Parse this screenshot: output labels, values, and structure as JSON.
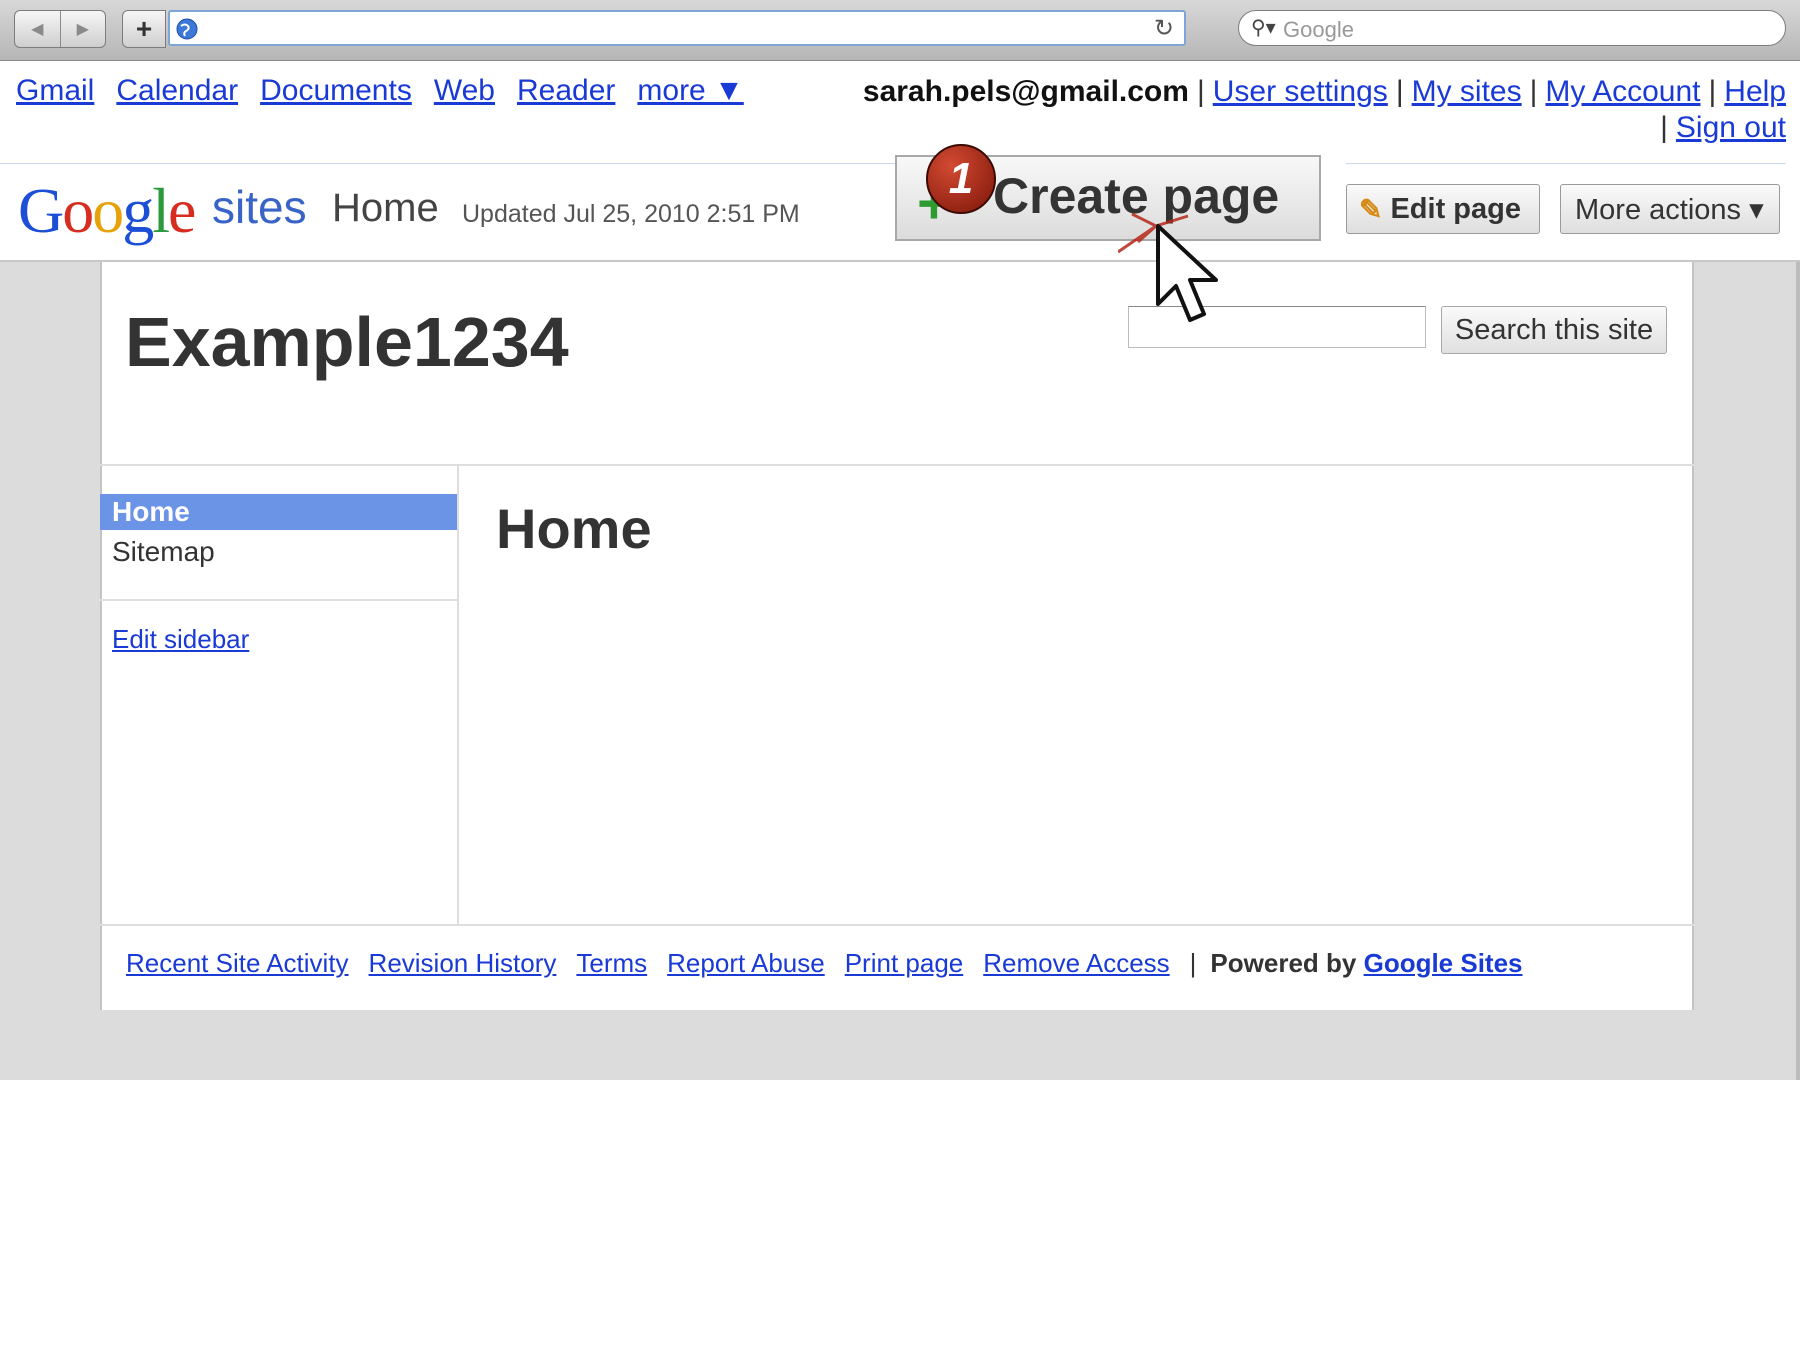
{
  "browser": {
    "url": "",
    "search_placeholder": "Google"
  },
  "toplinks": {
    "left": [
      "Gmail",
      "Calendar",
      "Documents",
      "Web",
      "Reader",
      "more ▼"
    ],
    "email": "sarah.pels@gmail.com",
    "right": [
      "User settings",
      "My sites",
      "My Account",
      "Help",
      "Sign out"
    ]
  },
  "header": {
    "logo_letters": [
      "G",
      "o",
      "o",
      "g",
      "l",
      "e"
    ],
    "sites_word": "sites",
    "page_name": "Home",
    "updated": "Updated Jul 25, 2010 2:51 PM",
    "create_page": "Create page",
    "step_badge": "1",
    "edit_page": "Edit page",
    "more_actions": "More actions ▾"
  },
  "site": {
    "title": "Example1234",
    "search_button": "Search this site",
    "sidebar": {
      "items": [
        {
          "label": "Home",
          "selected": true
        },
        {
          "label": "Sitemap",
          "selected": false
        }
      ],
      "edit_sidebar": "Edit sidebar"
    },
    "content_title": "Home",
    "footer": {
      "links": [
        "Recent Site Activity",
        "Revision History",
        "Terms",
        "Report Abuse",
        "Print page",
        "Remove Access"
      ],
      "powered_by": "Powered by",
      "powered_link": "Google Sites"
    }
  },
  "colors": {
    "link": "#1a3ad6",
    "nav_selected": "#6b93e6",
    "badge": "#a8260f",
    "plus_green": "#2f9a2f"
  },
  "icons": [
    "back-arrow-icon",
    "forward-arrow-icon",
    "plus-icon",
    "globe-icon",
    "reload-icon",
    "magnifier-icon",
    "pencil-icon",
    "cursor-icon"
  ]
}
